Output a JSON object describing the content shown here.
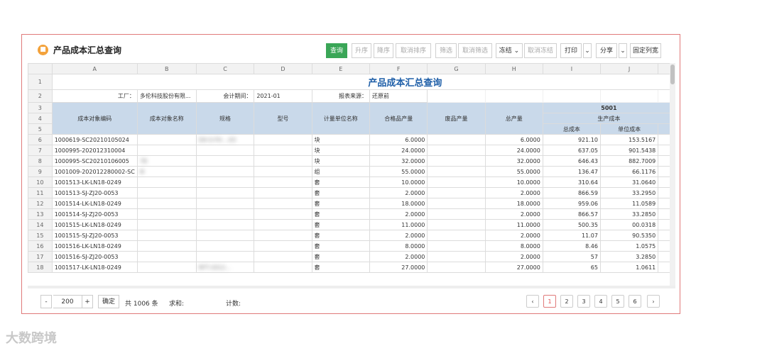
{
  "app": {
    "title": "产品成本汇总查询",
    "icon": "report-icon"
  },
  "toolbar": {
    "query": "查询",
    "asc": "升序",
    "desc": "降序",
    "cancel_sort": "取消排序",
    "filter": "筛选",
    "cancel_filter": "取消筛选",
    "freeze": "冻结",
    "unfreeze": "取消冻结",
    "print": "打印",
    "share": "分享",
    "fix_width": "固定列宽"
  },
  "columns": [
    "A",
    "B",
    "C",
    "D",
    "E",
    "F",
    "G",
    "H",
    "I",
    "J"
  ],
  "report": {
    "title": "产品成本汇总查询",
    "factory_label": "工厂：",
    "factory_value": "多伦科技股份有限...",
    "period_label": "会计期间：",
    "period_value": "2021-01",
    "source_label": "报表来源：",
    "source_value": "还原前"
  },
  "headers": {
    "code": "成本对象编码",
    "name": "成本对象名称",
    "spec": "规格",
    "model": "型号",
    "unit": "计量单位名称",
    "good": "合格品产量",
    "scrap": "废品产量",
    "total": "总产量",
    "group": "5001",
    "sub": "生产成本",
    "total_cost": "总成本",
    "unit_cost": "单位成本"
  },
  "rows": [
    {
      "n": "6",
      "code": "1000619-SC20210105024",
      "name": "",
      "spec": "DX-S-F0-...03",
      "unit": "块",
      "good": "6.0000",
      "total": "6.0000",
      "tc": "921.10",
      "uc": "153.5167"
    },
    {
      "n": "7",
      "code": "1000995-202012310004",
      "name": "",
      "spec": "",
      "unit": "块",
      "good": "24.0000",
      "total": "24.0000",
      "tc": "637.05",
      "uc": "901.5438"
    },
    {
      "n": "8",
      "code": "1000995-SC20210106005",
      "name": "78",
      "spec": "",
      "unit": "块",
      "good": "32.0000",
      "total": "32.0000",
      "tc": "646.43",
      "uc": "882.7009"
    },
    {
      "n": "9",
      "code": "1001009-202012280002-SC",
      "name": "Φ",
      "spec": "",
      "unit": "组",
      "good": "55.0000",
      "total": "55.0000",
      "tc": "136.47",
      "uc": "66.1176"
    },
    {
      "n": "10",
      "code": "1001513-LK-LN18-0249",
      "name": "",
      "spec": "",
      "unit": "套",
      "good": "10.0000",
      "total": "10.0000",
      "tc": "310.64",
      "uc": "31.0640"
    },
    {
      "n": "11",
      "code": "1001513-SJ-ZJ20-0053",
      "name": "",
      "spec": "",
      "unit": "套",
      "good": "2.0000",
      "total": "2.0000",
      "tc": "866.59",
      "uc": "33.2950"
    },
    {
      "n": "12",
      "code": "1001514-LK-LN18-0249",
      "name": "",
      "spec": "",
      "unit": "套",
      "good": "18.0000",
      "total": "18.0000",
      "tc": "959.06",
      "uc": "11.0589"
    },
    {
      "n": "13",
      "code": "1001514-SJ-ZJ20-0053",
      "name": "",
      "spec": "",
      "unit": "套",
      "good": "2.0000",
      "total": "2.0000",
      "tc": "866.57",
      "uc": "33.2850"
    },
    {
      "n": "14",
      "code": "1001515-LK-LN18-0249",
      "name": "",
      "spec": "",
      "unit": "套",
      "good": "11.0000",
      "total": "11.0000",
      "tc": "500.35",
      "uc": "00.0318"
    },
    {
      "n": "15",
      "code": "1001515-SJ-ZJ20-0053",
      "name": "",
      "spec": "",
      "unit": "套",
      "good": "2.0000",
      "total": "2.0000",
      "tc": "11.07",
      "uc": "90.5350"
    },
    {
      "n": "16",
      "code": "1001516-LK-LN18-0249",
      "name": "",
      "spec": "",
      "unit": "套",
      "good": "8.0000",
      "total": "8.0000",
      "tc": "8.46",
      "uc": "1.0575"
    },
    {
      "n": "17",
      "code": "1001516-SJ-ZJ20-0053",
      "name": "",
      "spec": "",
      "unit": "套",
      "good": "2.0000",
      "total": "2.0000",
      "tc": "57",
      "uc": "3.2850"
    },
    {
      "n": "18",
      "code": "1001517-LK-LN18-0249",
      "name": "",
      "spec": "RFT-2012...",
      "unit": "套",
      "good": "27.0000",
      "total": "27.0000",
      "tc": "65",
      "uc": "1.0611"
    }
  ],
  "footer": {
    "minus": "-",
    "page_size": "200",
    "plus": "+",
    "confirm": "确定",
    "total_records": "共 1006 条",
    "sum_label": "求和:",
    "count_label": "计数:",
    "prev": "‹",
    "next": "›",
    "pages": [
      "1",
      "2",
      "3",
      "4",
      "5",
      "6"
    ]
  },
  "watermark": "大数跨境"
}
